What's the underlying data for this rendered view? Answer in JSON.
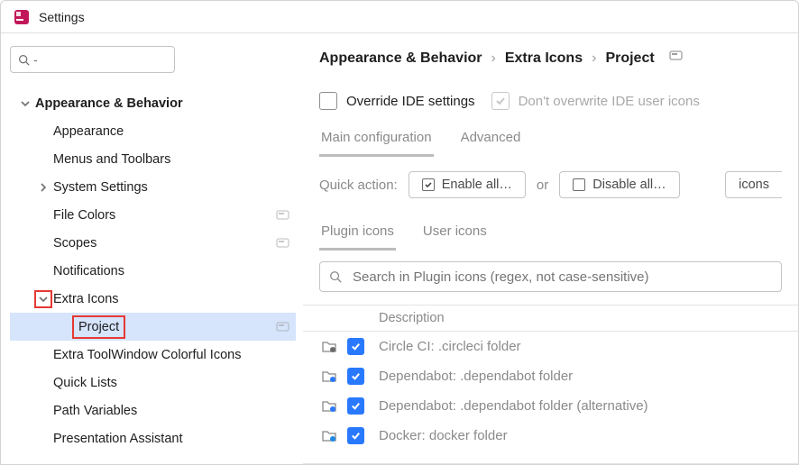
{
  "window": {
    "title": "Settings"
  },
  "search": {
    "placeholder": ""
  },
  "tree": {
    "root": {
      "label": "Appearance & Behavior"
    },
    "items": [
      {
        "label": "Appearance",
        "indent": 48
      },
      {
        "label": "Menus and Toolbars",
        "indent": 48
      },
      {
        "label": "System Settings",
        "indent": 48,
        "hasChildren": true,
        "expanded": false
      },
      {
        "label": "File Colors",
        "indent": 48,
        "tagged": true
      },
      {
        "label": "Scopes",
        "indent": 48,
        "tagged": true
      },
      {
        "label": "Notifications",
        "indent": 48
      },
      {
        "label": "Extra Icons",
        "indent": 48,
        "hasChildren": true,
        "expanded": true,
        "highlightExpander": true
      },
      {
        "label": "Project",
        "indent": 70,
        "selected": true,
        "highlightLabel": true,
        "tagged": true
      },
      {
        "label": "Extra ToolWindow Colorful Icons",
        "indent": 48
      },
      {
        "label": "Quick Lists",
        "indent": 48
      },
      {
        "label": "Path Variables",
        "indent": 48
      },
      {
        "label": "Presentation Assistant",
        "indent": 48
      }
    ]
  },
  "breadcrumb": {
    "parts": [
      "Appearance & Behavior",
      "Extra Icons",
      "Project"
    ],
    "sep": "›"
  },
  "options": {
    "override": {
      "label": "Override IDE settings",
      "checked": false
    },
    "dontOverwrite": {
      "label": "Don't overwrite IDE user icons",
      "checked": true,
      "disabled": true
    }
  },
  "tabs": {
    "main": [
      {
        "id": "main",
        "label": "Main configuration",
        "active": true
      },
      {
        "id": "advanced",
        "label": "Advanced",
        "active": false
      }
    ]
  },
  "quick": {
    "label": "Quick action:",
    "enable": "Enable all…",
    "or": "or",
    "disable": "Disable all…",
    "icons": "icons"
  },
  "iconTabs": [
    {
      "id": "plugin",
      "label": "Plugin icons",
      "active": true
    },
    {
      "id": "user",
      "label": "User icons",
      "active": false
    }
  ],
  "pluginSearch": {
    "placeholder": "Search in Plugin icons (regex, not case-sensitive)"
  },
  "table": {
    "header": {
      "description": "Description"
    },
    "rows": [
      {
        "desc": "Circle CI: .circleci folder",
        "checked": true,
        "iconColor": "#6b6b6b"
      },
      {
        "desc": "Dependabot: .dependabot folder",
        "checked": true,
        "iconColor": "#2979ff"
      },
      {
        "desc": "Dependabot: .dependabot folder (alternative)",
        "checked": true,
        "iconColor": "#2979ff"
      },
      {
        "desc": "Docker: docker folder",
        "checked": true,
        "iconColor": "#1e88e5"
      }
    ]
  }
}
